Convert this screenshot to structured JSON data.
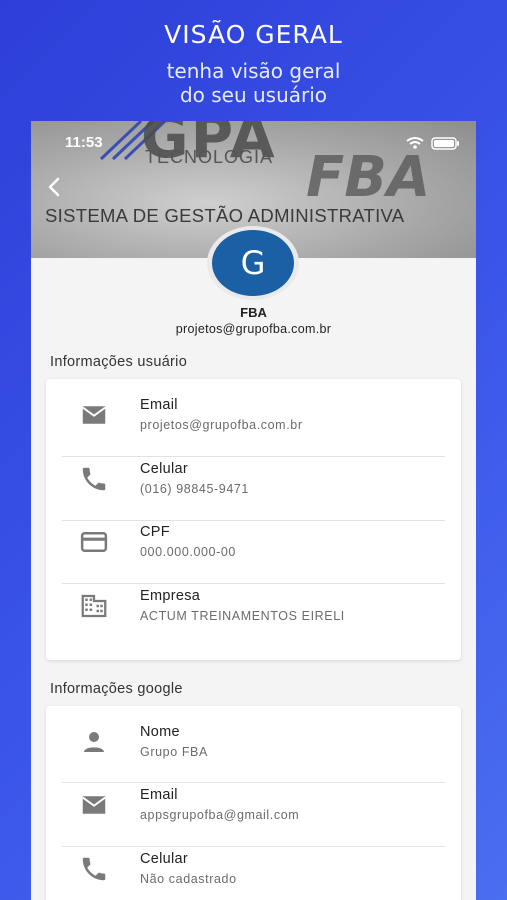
{
  "promo": {
    "title": "VISÃO GERAL",
    "subtitle_line1": "tenha visão geral",
    "subtitle_line2": "do seu usuário"
  },
  "status_bar": {
    "time": "11:53"
  },
  "header": {
    "watermark_top": "GPA",
    "watermark_tecnologia": "TECNOLOGIA",
    "watermark_fba": "FBA",
    "watermark_sistema": "SISTEMA DE GESTÃO ADMINISTRATIVA"
  },
  "profile": {
    "avatar_letter": "G",
    "avatar_color": "#1b5fa5",
    "name": "FBA",
    "email": "projetos@grupofba.com.br"
  },
  "user_info": {
    "title": "Informações usuário",
    "items": [
      {
        "icon": "mail-icon",
        "label": "Email",
        "value": "projetos@grupofba.com.br"
      },
      {
        "icon": "phone-icon",
        "label": "Celular",
        "value": "(016) 98845-9471"
      },
      {
        "icon": "card-icon",
        "label": "CPF",
        "value": "000.000.000-00"
      },
      {
        "icon": "building-icon",
        "label": "Empresa",
        "value": "ACTUM TREINAMENTOS EIRELI"
      }
    ]
  },
  "google_info": {
    "title": "Informações google",
    "items": [
      {
        "icon": "person-icon",
        "label": "Nome",
        "value": "Grupo FBA"
      },
      {
        "icon": "mail-icon",
        "label": "Email",
        "value": "appsgrupofba@gmail.com"
      },
      {
        "icon": "phone-icon",
        "label": "Celular",
        "value": "Não cadastrado"
      }
    ]
  }
}
